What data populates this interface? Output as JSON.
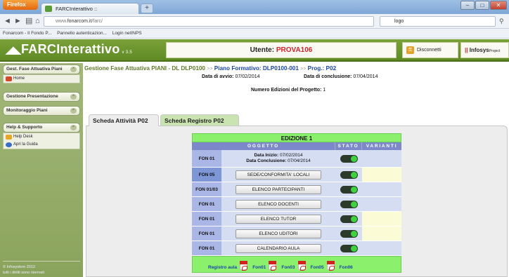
{
  "browser": {
    "firefox_label": "Firefox",
    "tab_title": "FARCInterattivo ::",
    "new_tab": "+",
    "url_prefix": "www.",
    "url_domain": "fonarcom.it",
    "url_path": "/farc/",
    "search_text": "logo",
    "bookmarks": [
      "Fonarcom - Il Fondo P...",
      "Pannello autenticazion...",
      "Login netINPS"
    ],
    "window_controls": [
      "–",
      "□",
      "✕"
    ]
  },
  "header": {
    "logo": "FARCInterattivo",
    "version": "v 3.5",
    "user_label": "Utente:",
    "user_name": "PROVA106",
    "logout_label": "Disconnetti",
    "brand": "Infosys",
    "brand_small": "Project"
  },
  "sidebar": {
    "sections": [
      {
        "title": "Gest. Fase Attuativa Piani",
        "items": [
          "Home"
        ]
      },
      {
        "title": "Gestione Presentazione",
        "items": []
      },
      {
        "title": "Monitoraggio Piani",
        "items": []
      },
      {
        "title": "Help & Supporto",
        "items": [
          "Help Desk",
          "Apri la Guida"
        ]
      }
    ],
    "footer_1": "© Infosystem 2012",
    "footer_2": "tutti i diritti sono riservati"
  },
  "main": {
    "breadcrumb_1": "Gestione Fase Attuativa PIANI - DL DLP0100",
    "breadcrumb_sep": ">>",
    "breadcrumb_2": "Piano Formativo: DLP0100-001",
    "breadcrumb_3": "Prog.: P02",
    "start_label": "Data di avvio:",
    "start_value": "07/02/2014",
    "end_label": "Data di conclusione:",
    "end_value": "07/04/2014",
    "editions_label": "Numero Edizioni del Progetto:",
    "editions_value": "1",
    "tabs": [
      "Scheda Attività P02",
      "Scheda Registro P02"
    ]
  },
  "grid": {
    "title": "EDIZIONE 1",
    "col_oggetto": "OGGETTO",
    "col_stato": "STATO",
    "col_varianti": "VARIANTI",
    "row_dates": {
      "code": "FON 01",
      "inizio_label": "Data Inizio:",
      "inizio": "07/02/2014",
      "concl_label": "Data Conclusione:",
      "concl": "07/04/2014"
    },
    "rows": [
      {
        "code": "FON 05",
        "label": "SEDE/CONFORMITA' LOCALI"
      },
      {
        "code": "FON 01/03",
        "label": "ELENCO PARTECIPANTI"
      },
      {
        "code": "FON 01",
        "label": "ELENCO DOCENTI"
      },
      {
        "code": "FON 01",
        "label": "ELENCO TUTOR"
      },
      {
        "code": "FON 01",
        "label": "ELENCO UDITORI"
      },
      {
        "code": "FON 01",
        "label": "CALENDARIO AULA"
      }
    ],
    "footer_links": [
      "Registro aula",
      "Fon01",
      "Fon03",
      "Fon05",
      "Fon06"
    ]
  }
}
